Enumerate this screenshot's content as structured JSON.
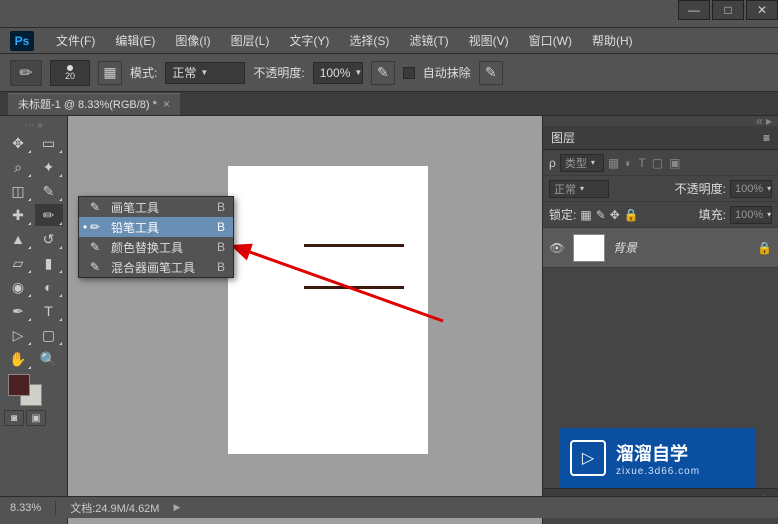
{
  "window": {
    "minimize": "—",
    "maximize": "□",
    "close": "✕"
  },
  "ps_logo": "Ps",
  "menu": {
    "file": "文件(F)",
    "edit": "编辑(E)",
    "image": "图像(I)",
    "layer": "图层(L)",
    "type": "文字(Y)",
    "select": "选择(S)",
    "filter": "滤镜(T)",
    "view": "视图(V)",
    "window": "窗口(W)",
    "help": "帮助(H)"
  },
  "options": {
    "brush_size": "20",
    "mode_label": "模式:",
    "mode_value": "正常",
    "opacity_label": "不透明度:",
    "opacity_value": "100%",
    "auto_erase": "自动抹除"
  },
  "tab": {
    "title": "未标题-1 @ 8.33%(RGB/8) *",
    "close": "×"
  },
  "flyout": {
    "items": [
      {
        "icon": "✎",
        "label": "画笔工具",
        "key": "B",
        "selected": false
      },
      {
        "icon": "✏",
        "label": "铅笔工具",
        "key": "B",
        "selected": true
      },
      {
        "icon": "✎",
        "label": "颜色替换工具",
        "key": "B",
        "selected": false
      },
      {
        "icon": "✎",
        "label": "混合器画笔工具",
        "key": "B",
        "selected": false
      }
    ]
  },
  "layers_panel": {
    "title": "图层",
    "kind_label": "类型",
    "blend_mode": "正常",
    "opacity_label": "不透明度:",
    "opacity_value": "100%",
    "lock_label": "锁定:",
    "fill_label": "填充:",
    "fill_value": "100%",
    "layer_name": "背景"
  },
  "status": {
    "zoom": "8.33%",
    "doc_label": "文档:",
    "doc_size": "24.9M/4.62M"
  },
  "watermark": {
    "main": "溜溜自学",
    "sub": "zixue.3d66.com",
    "play": "▷"
  },
  "colors": {
    "foreground": "#4a2020",
    "background": "#d0d0c8"
  }
}
